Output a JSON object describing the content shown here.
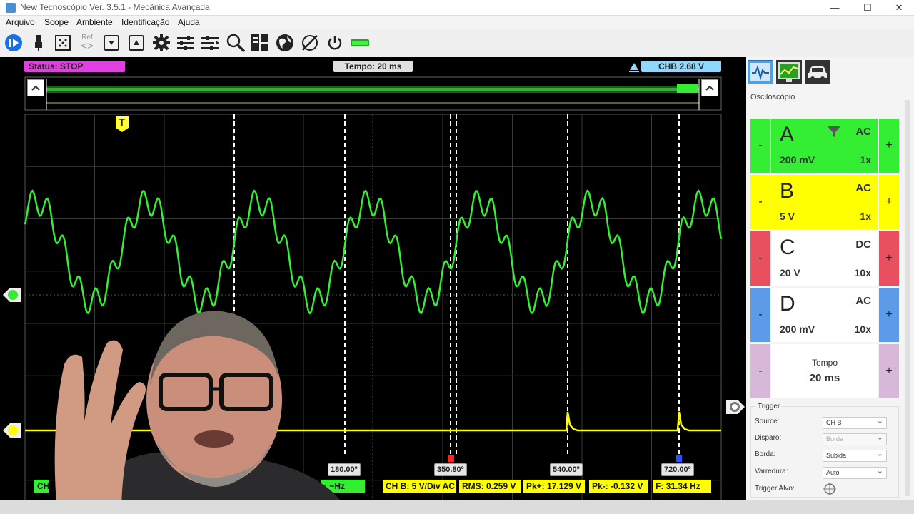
{
  "window": {
    "title": "New Tecnoscópio Ver. 3.5.1  - Mecânica Avançada",
    "minimize": "—",
    "maximize": "☐",
    "close": "✕"
  },
  "menu": [
    "Arquivo",
    "Scope",
    "Ambiente",
    "Identificação",
    "Ajuda"
  ],
  "toolbar": {
    "ref_label": "Ref",
    "icons": [
      "play-pause-icon",
      "probe-icon",
      "grid-icon",
      "ref-arrows-icon",
      "save-icon",
      "load-icon",
      "gear-icon",
      "filter-sliders-icon",
      "adjust-sliders-icon",
      "zoom-icon",
      "layout-icon",
      "globe-icon",
      "compass-icon",
      "power-icon",
      "battery-icon"
    ]
  },
  "scope": {
    "status": "Status: STOP",
    "tempo": "Tempo: 20 ms",
    "trigger_ch": "CHB 2.68 V",
    "trigger_marker": "T",
    "degree_cursors": [
      "180.00º",
      "350.80º",
      "540.00º",
      "720.00º"
    ],
    "measurements": {
      "left_partial": "CH",
      "freq_partial": ": ~Hz",
      "ch_b": "CH B: 5 V/Div AC",
      "rms": "RMS: 0.259 V",
      "pk_plus": "Pk+: 17.129 V",
      "pk_minus": "Pk-: -0.132 V",
      "freq": "F: 31.34 Hz"
    },
    "colors": {
      "ch_a": "#33ee33",
      "ch_b": "#ffff00",
      "status_bg": "#e040e0",
      "trigger_bg": "#8ed8ff"
    }
  },
  "panel": {
    "section_title": "Osciloscópio",
    "tabs": [
      "waveform-tab-icon",
      "monitor-tab-icon",
      "car-tab-icon"
    ],
    "channels": [
      {
        "letter": "A",
        "coupling": "AC",
        "volts": "200 mV",
        "probe": "1x",
        "color": "#33ee33",
        "has_filter": true
      },
      {
        "letter": "B",
        "coupling": "AC",
        "volts": "5 V",
        "probe": "1x",
        "color": "#ffff00",
        "has_filter": false
      },
      {
        "letter": "C",
        "coupling": "DC",
        "volts": "20 V",
        "probe": "10x",
        "color": "#e85060",
        "has_filter": false
      },
      {
        "letter": "D",
        "coupling": "AC",
        "volts": "200 mV",
        "probe": "10x",
        "color": "#5b9be8",
        "has_filter": false
      }
    ],
    "minus": "-",
    "plus": "+",
    "tempo_title": "Tempo",
    "tempo_value": "20 ms",
    "tempo_color": "#d8b8d8",
    "trigger": {
      "title": "Trigger",
      "source_label": "Source:",
      "source_value": "CH B",
      "disparo_label": "Disparo:",
      "disparo_value": "Borda",
      "borda_label": "Borda:",
      "borda_value": "Subida",
      "varredura_label": "Varredura:",
      "varredura_value": "Auto",
      "alvo_label": "Trigger Alvo:"
    }
  }
}
